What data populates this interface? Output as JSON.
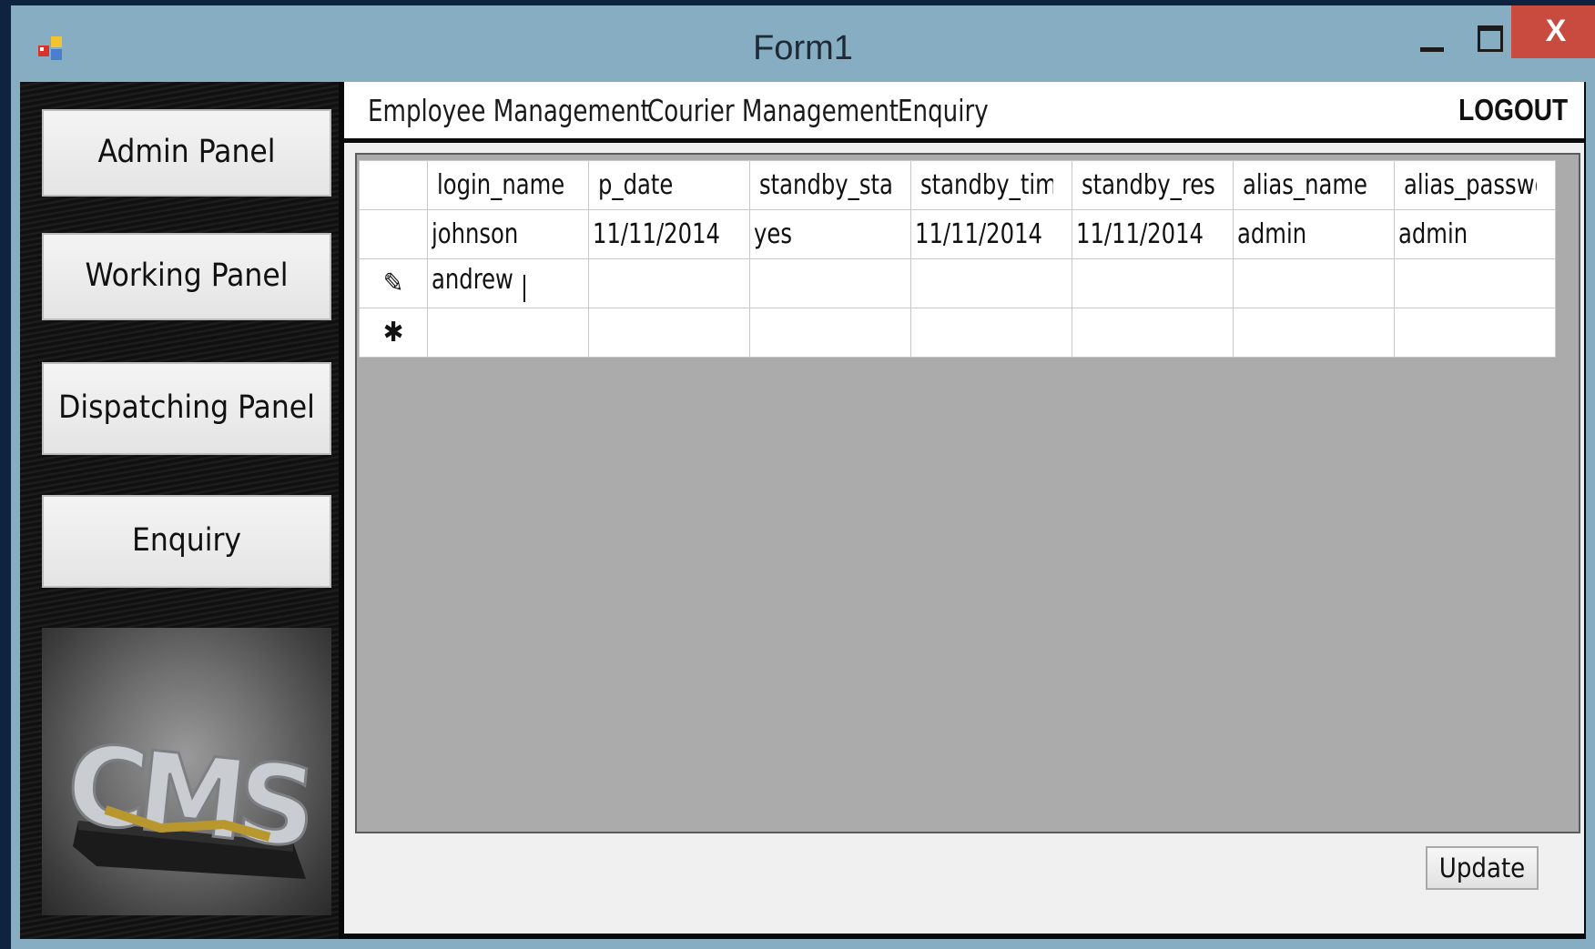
{
  "window": {
    "title": "Form1",
    "close_glyph": "X"
  },
  "sidebar": {
    "buttons": [
      {
        "label": "Admin Panel"
      },
      {
        "label": "Working Panel"
      },
      {
        "label": "Dispatching Panel"
      },
      {
        "label": "Enquiry"
      }
    ],
    "logo_text": "CMS"
  },
  "menu": {
    "items": [
      {
        "label": "Employee Management"
      },
      {
        "label": "Courier Management"
      },
      {
        "label": "Enquiry"
      }
    ],
    "logout": "LOGOUT"
  },
  "grid": {
    "columns": [
      "login_name",
      "p_date",
      "standby_status",
      "standby_time",
      "standby_resume",
      "alias_name",
      "alias_password"
    ],
    "columns_visible": [
      "login_name",
      "p_date",
      "standby_statu:",
      "standby_time",
      "standby_resur",
      "alias_name",
      "alias_passwor"
    ],
    "rows": [
      {
        "indicator": "",
        "cells": [
          "johnson",
          "11/11/2014",
          "yes",
          "11/11/2014",
          "11/11/2014",
          "admin",
          "admin"
        ]
      },
      {
        "indicator": "✎",
        "cells": [
          "andrew",
          "",
          "",
          "",
          "",
          "",
          ""
        ]
      },
      {
        "indicator": "✱",
        "cells": [
          "",
          "",
          "",
          "",
          "",
          "",
          ""
        ]
      }
    ]
  },
  "actions": {
    "update_label": "Update"
  },
  "colors": {
    "titlebar": "#86adc2",
    "close": "#c94a3e",
    "grid_bg": "#ababab"
  }
}
